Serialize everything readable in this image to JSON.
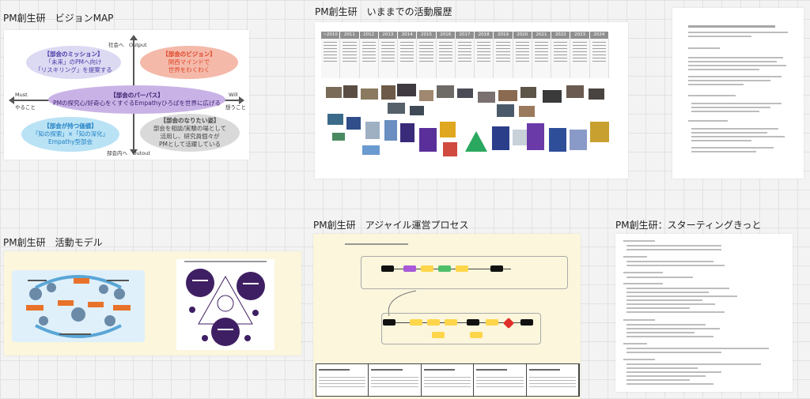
{
  "frames": {
    "vision_map": "PM創生研　ビジョンMAP",
    "history": "PM創生研　いままでの活動履歴",
    "activity_model": "PM創生研　活動モデル",
    "agile_process": "PM創生研　アジャイル運営プロセス",
    "starting_kit": "PM創生研：スターティングきっと"
  },
  "vision_map": {
    "axes": {
      "top": "社会へ　Output",
      "bottom": "部会内へ　Outout",
      "left_line1": "Must",
      "left_line2": "やること",
      "right_line1": "Will",
      "right_line2": "想うこと"
    },
    "mission": {
      "title": "【部会のミッション】",
      "line1": "「未来」のPMへ向け",
      "line2": "「リスキリング」を提案する"
    },
    "vision": {
      "title": "【部会のビジョン】",
      "line1": "関西マインドで",
      "line2": "世界をわくわく"
    },
    "purpose": {
      "title": "【部会のパーパス】",
      "line1": "PMの探究心/好奇心をくすぐるEmpathyひろばを世界に広げる"
    },
    "values": {
      "title": "【部会が持つ価値】",
      "line1": "「知の探索」×「知の深化」",
      "line2": "Empathy型部会"
    },
    "ideal": {
      "title": "【部会のなりたい姿】",
      "line1": "部会を相談/実験の場として",
      "line2": "活用し、研究員個々が",
      "line3": "PMとして活躍している"
    }
  },
  "history": {
    "years": [
      "~2010",
      "2011",
      "2012",
      "2013",
      "2014",
      "2015",
      "2016",
      "2017",
      "2018",
      "2019",
      "2020",
      "2021",
      "2022",
      "2023",
      "2024"
    ]
  },
  "colors": {
    "mission": "#dcd9f3",
    "vision": "#f4b9a9",
    "purpose": "#c9b3e6",
    "values": "#b9e2f5",
    "ideal": "#d9d9d9",
    "mission_text": "#4b3aa8",
    "vision_text": "#e0462a",
    "values_text": "#1f7fc4",
    "history_header": "#8f8f8f",
    "activity_bg": "#fbf6dc",
    "agile_bg": "#fbf6dc",
    "am_purple": "#3f1f63"
  }
}
